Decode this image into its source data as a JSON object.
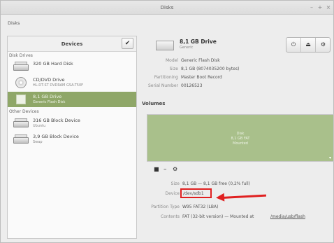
{
  "window": {
    "title": "Disks",
    "controls": {
      "minimize": "–",
      "maximize": "+",
      "close": "×"
    }
  },
  "app_menu": {
    "label": "Disks"
  },
  "devices_panel": {
    "title": "Devices",
    "check_label": "✔",
    "sections": {
      "disk_drives": "Disk Drives",
      "other_devices": "Other Devices"
    },
    "drives": [
      {
        "name": "320 GB Hard Disk",
        "sub": "",
        "icon": "hard-disk-icon",
        "selected": false
      },
      {
        "name": "CD/DVD Drive",
        "sub": "HL-DT-ST DVDRAM GSA-T50F",
        "icon": "optical-drive-icon",
        "selected": false
      },
      {
        "name": "8,1 GB Drive",
        "sub": "Generic Flash Disk",
        "icon": "usb-drive-icon",
        "selected": true
      }
    ],
    "other": [
      {
        "name": "316 GB Block Device",
        "sub": "Ubuntu",
        "icon": "block-device-icon"
      },
      {
        "name": "3,9 GB Block Device",
        "sub": "Swap",
        "icon": "block-device-icon"
      }
    ]
  },
  "drive_header": {
    "title": "8,1 GB Drive",
    "subtitle": "Generic",
    "power_icon": "⏻",
    "eject_icon": "⏏",
    "settings_icon": "⚙"
  },
  "drive_props": [
    {
      "key": "Model",
      "value": "Generic Flash Disk"
    },
    {
      "key": "Size",
      "value": "8,1 GB (8074035200 bytes)"
    },
    {
      "key": "Partitioning",
      "value": "Master Boot Record"
    },
    {
      "key": "Serial Number",
      "value": "00126523"
    }
  ],
  "volumes": {
    "label": "Volumes",
    "partition": {
      "line1": "Disk",
      "line2": "8,1 GB FAT",
      "line3": "Mounted"
    },
    "tools": {
      "add": "■",
      "remove": "–",
      "settings": "⚙"
    }
  },
  "volume_props": [
    {
      "key": "Size",
      "value": "8,1 GB — 8,1 GB free (0,2% full)"
    },
    {
      "key": "Device",
      "value": "/dev/sdb1"
    },
    {
      "key": "Partition Type",
      "value": "W95 FAT32 (LBA)"
    },
    {
      "key": "Contents",
      "value": "FAT (32-bit version) — Mounted at",
      "link": "/media/usb/flash"
    }
  ],
  "colors": {
    "selected_row": "#8fa768",
    "partition_fill": "#a9c08b",
    "annotation": "#e02020"
  }
}
